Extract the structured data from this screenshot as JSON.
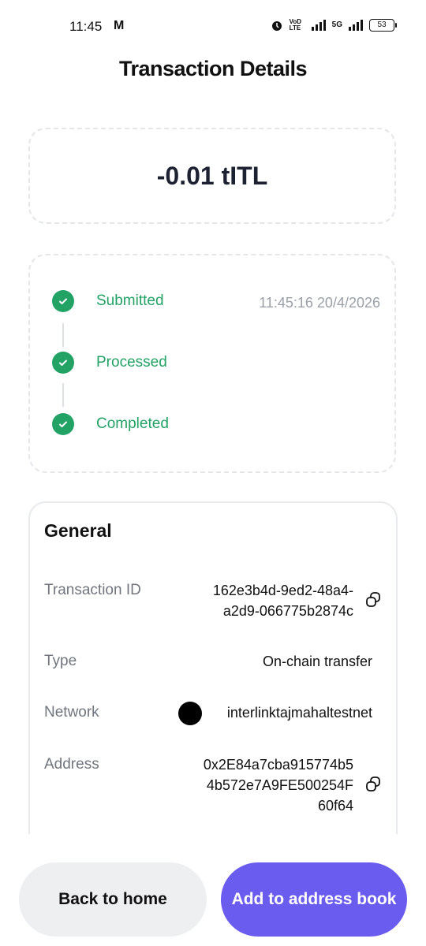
{
  "status_bar": {
    "time": "11:45",
    "mail_icon": "M",
    "volte": "VoD LTE",
    "network": "5G",
    "battery": "53"
  },
  "page": {
    "title": "Transaction Details"
  },
  "amount": "-0.01 tITL",
  "timeline": {
    "steps": [
      {
        "label": "Submitted"
      },
      {
        "label": "Processed"
      },
      {
        "label": "Completed"
      }
    ],
    "timestamp": "11:45:16 20/4/2026"
  },
  "general": {
    "title": "General",
    "transaction_id": {
      "label": "Transaction ID",
      "value_line1": "162e3b4d-9ed2-48a4-",
      "value_line2": "a2d9-066775b2874c"
    },
    "type": {
      "label": "Type",
      "value": "On-chain transfer"
    },
    "network": {
      "label": "Network",
      "value": "interlinktajmahaltestnet"
    },
    "address": {
      "label": "Address",
      "value_line1": "0x2E84a7cba915774b5",
      "value_line2": "4b572e7A9FE500254F",
      "value_line3": "60f64"
    }
  },
  "buttons": {
    "back": "Back to home",
    "add": "Add to address book"
  },
  "colors": {
    "accent": "#6b5cf0",
    "success": "#22a365"
  }
}
